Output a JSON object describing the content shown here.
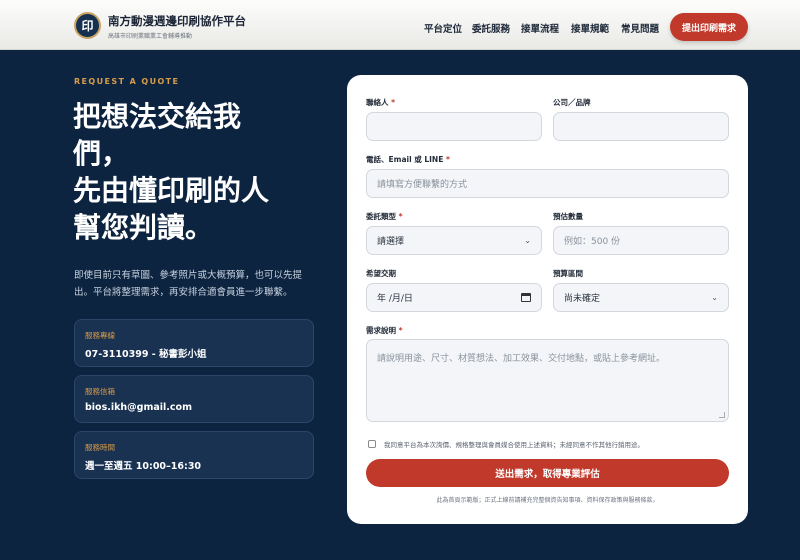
{
  "header": {
    "logo_char": "印",
    "title": "南方動漫週邊印刷協作平台",
    "subtitle": "高雄市印刷業職業工會輔導推動",
    "nav": [
      "平台定位",
      "委託服務",
      "接單流程",
      "接單規範",
      "常見問題"
    ],
    "cta": "提出印刷需求"
  },
  "hero": {
    "eyebrow": "REQUEST A QUOTE",
    "headline_lines": [
      "把想法交給我",
      "們，",
      "先由懂印刷的人",
      "幫您判讀。"
    ],
    "intro": "即使目前只有草圖、參考照片或大概預算，也可以先提出。平台將整理需求，再安排合適會員進一步聯繫。"
  },
  "info_cards": [
    {
      "label": "服務專線",
      "value": "07-3110399 - 秘書彭小姐"
    },
    {
      "label": "服務信箱",
      "value": "bios.ikh@gmail.com"
    },
    {
      "label": "服務時間",
      "value": "週一至週五 10:00–16:30"
    }
  ],
  "form": {
    "contact_label": "聯絡人",
    "company_label": "公司／品牌",
    "phone_label": "電話、Email 或 LINE",
    "phone_placeholder": "請填寫方便聯繫的方式",
    "type_label": "委託類型",
    "type_value": "請選擇",
    "quantity_label": "預估數量",
    "quantity_placeholder": "例如：500 份",
    "date_label": "希望交期",
    "date_value": "年 /月/日",
    "budget_label": "預算區間",
    "budget_value": "尚未確定",
    "desc_label": "需求說明",
    "desc_placeholder": "請說明用途、尺寸、材質想法、加工效果、交付地點，或貼上參考網址。",
    "required_mark": "*",
    "agree_text": "我同意平台為本次詢價、規格整理與會員媒合使用上述資料；未經同意不作其他行銷用途。",
    "submit": "送出需求，取得專業評估",
    "footnote": "此為首頁示範版；正式上線前請補充完整個資告知事項、資料保存政策與服務條款。"
  },
  "colors": {
    "page_bg": "#0d2440",
    "accent": "#c0392b",
    "gold": "#d59c4a"
  },
  "icons": {
    "select": "chevron-down-icon",
    "date": "calendar-icon"
  }
}
